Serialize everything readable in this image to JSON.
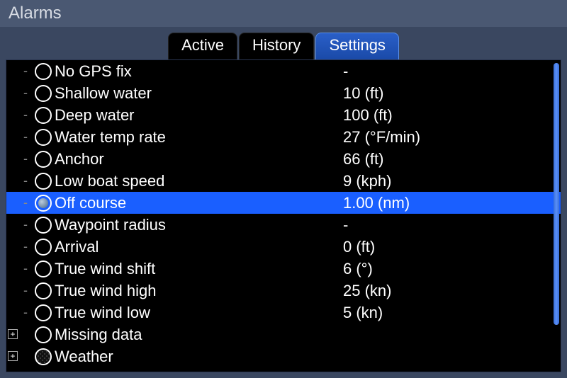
{
  "header": {
    "title": "Alarms"
  },
  "tabs": [
    {
      "label": "Active",
      "active": false
    },
    {
      "label": "History",
      "active": false
    },
    {
      "label": "Settings",
      "active": true
    }
  ],
  "alarms": [
    {
      "label": "No GPS fix",
      "value": "-",
      "selected": false,
      "expandable": false,
      "filled": false,
      "dotted": false
    },
    {
      "label": "Shallow water",
      "value": "10 (ft)",
      "selected": false,
      "expandable": false,
      "filled": false,
      "dotted": false
    },
    {
      "label": "Deep water",
      "value": "100 (ft)",
      "selected": false,
      "expandable": false,
      "filled": false,
      "dotted": false
    },
    {
      "label": "Water temp rate",
      "value": "27 (°F/min)",
      "selected": false,
      "expandable": false,
      "filled": false,
      "dotted": false
    },
    {
      "label": "Anchor",
      "value": "66 (ft)",
      "selected": false,
      "expandable": false,
      "filled": false,
      "dotted": false
    },
    {
      "label": "Low boat speed",
      "value": "9 (kph)",
      "selected": false,
      "expandable": false,
      "filled": false,
      "dotted": false
    },
    {
      "label": "Off course",
      "value": "1.00 (nm)",
      "selected": true,
      "expandable": false,
      "filled": true,
      "dotted": false
    },
    {
      "label": "Waypoint radius",
      "value": "-",
      "selected": false,
      "expandable": false,
      "filled": false,
      "dotted": false
    },
    {
      "label": "Arrival",
      "value": "0 (ft)",
      "selected": false,
      "expandable": false,
      "filled": false,
      "dotted": false
    },
    {
      "label": "True wind shift",
      "value": "6 (°)",
      "selected": false,
      "expandable": false,
      "filled": false,
      "dotted": false
    },
    {
      "label": "True wind high",
      "value": "25 (kn)",
      "selected": false,
      "expandable": false,
      "filled": false,
      "dotted": false
    },
    {
      "label": "True wind low",
      "value": "5 (kn)",
      "selected": false,
      "expandable": false,
      "filled": false,
      "dotted": false
    },
    {
      "label": "Missing data",
      "value": "",
      "selected": false,
      "expandable": true,
      "filled": false,
      "dotted": false
    },
    {
      "label": "Weather",
      "value": "",
      "selected": false,
      "expandable": true,
      "filled": false,
      "dotted": true
    }
  ]
}
